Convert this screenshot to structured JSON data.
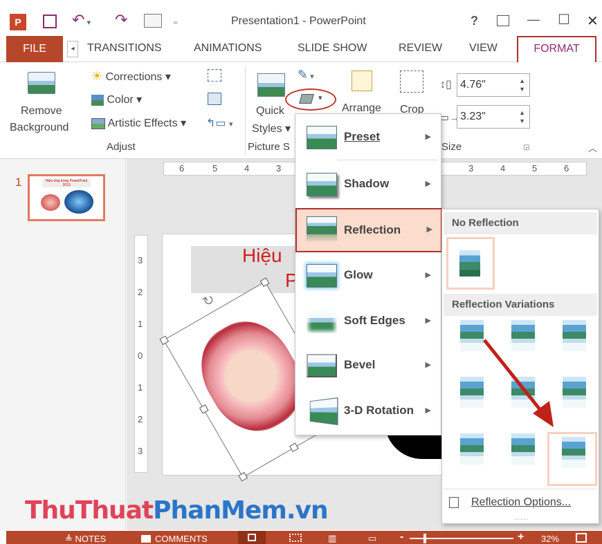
{
  "window": {
    "title": "Presentation1 - PowerPoint",
    "help": "?",
    "min": "—",
    "max": "☐",
    "close": "✕"
  },
  "tabs": [
    "FILE",
    "TRANSITIONS",
    "ANIMATIONS",
    "SLIDE SHOW",
    "REVIEW",
    "VIEW",
    "FORMAT"
  ],
  "ribbon": {
    "remove_bg_1": "Remove",
    "remove_bg_2": "Background",
    "corrections": "Corrections ▾",
    "color": "Color ▾",
    "artistic": "Artistic Effects ▾",
    "adjust_group": "Adjust",
    "quick_1": "Quick",
    "quick_2": "Styles ▾",
    "picture_styles_group": "Picture S",
    "arrange": "Arrange",
    "crop": "Crop",
    "height": "4.76\"",
    "width": "3.23\"",
    "size_group": "Size"
  },
  "thumbnail": {
    "number": "1",
    "text": "Hiệu ứng trong PowerPoint 2013"
  },
  "ruler_top": [
    "6",
    "5",
    "4",
    "3",
    "3",
    "4",
    "5",
    "6"
  ],
  "ruler_left": [
    "3",
    "2",
    "1",
    "0",
    "1",
    "2",
    "3"
  ],
  "slide": {
    "title_1": "Hiệu",
    "title_2": "P"
  },
  "effects_menu": [
    {
      "label": "Preset",
      "key": "P"
    },
    {
      "label": "Shadow",
      "key": "S"
    },
    {
      "label": "Reflection",
      "key": "R"
    },
    {
      "label": "Glow",
      "key": "G"
    },
    {
      "label": "Soft Edges",
      "key": "E"
    },
    {
      "label": "Bevel",
      "key": "B"
    },
    {
      "label": "3-D Rotation",
      "key": "D"
    }
  ],
  "reflection_panel": {
    "no_reflection": "No Reflection",
    "variations": "Reflection Variations",
    "options": "Reflection Options...",
    "grip": "....."
  },
  "watermark": {
    "part1": "ThuThuat",
    "part2": "PhanMem",
    "part3": ".vn"
  },
  "status": {
    "notes": "≜ NOTES",
    "comments": "COMMENTS",
    "zoom": "32%",
    "minus": "-",
    "plus": "+"
  },
  "colors": {
    "accent": "#b7472a",
    "highlight": "#c0392b",
    "menu_hover": "#fcdccc"
  }
}
